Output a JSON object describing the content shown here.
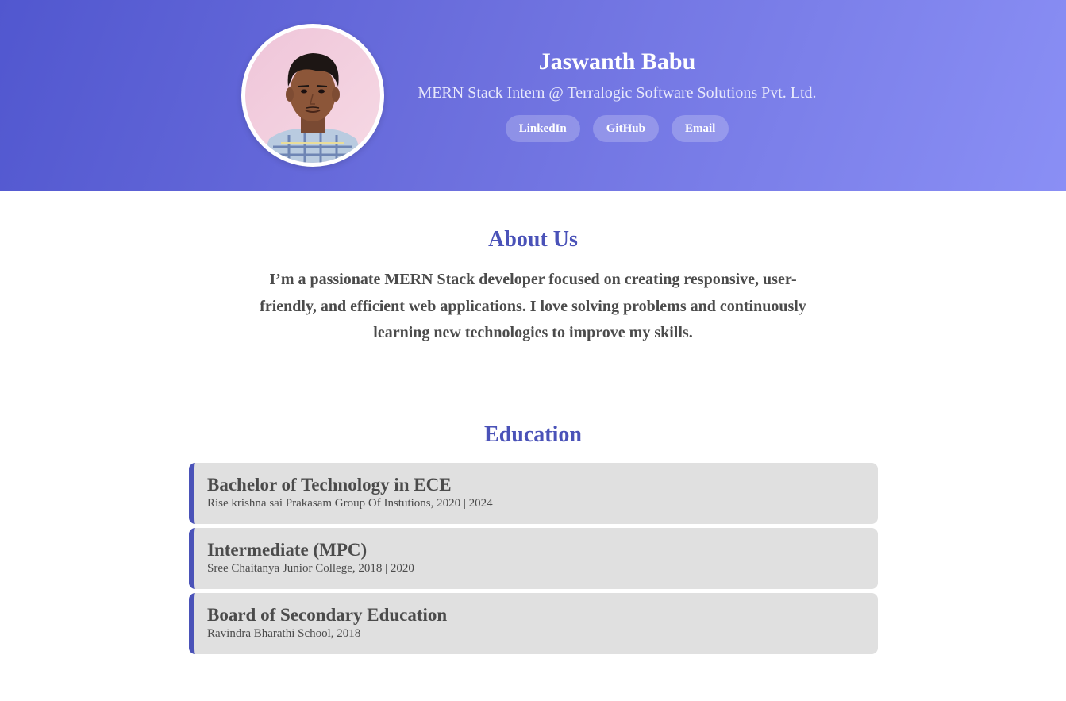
{
  "header": {
    "name": "Jaswanth Babu",
    "role": "MERN Stack Intern @ Terralogic Software Solutions Pvt. Ltd.",
    "links": [
      "LinkedIn",
      "GitHub",
      "Email"
    ]
  },
  "about": {
    "title": "About Us",
    "text": "I’m a passionate MERN Stack developer focused on creating responsive, user-friendly, and efficient web applications. I love solving problems and continuously learning new technologies to improve my skills."
  },
  "education": {
    "title": "Education",
    "items": [
      {
        "degree": "Bachelor of Technology in ECE",
        "meta": "Rise krishna sai Prakasam Group Of Instutions, 2020 | 2024"
      },
      {
        "degree": "Intermediate (MPC)",
        "meta": "Sree Chaitanya Junior College, 2018 | 2020"
      },
      {
        "degree": "Board of Secondary Education",
        "meta": "Ravindra Bharathi School, 2018"
      }
    ]
  },
  "colors": {
    "accent": "#4a52b8",
    "hero_start": "#5157cf",
    "hero_end": "#8a8ff5",
    "card_bg": "#e0e0e0"
  },
  "icons": [
    "profile-photo"
  ]
}
